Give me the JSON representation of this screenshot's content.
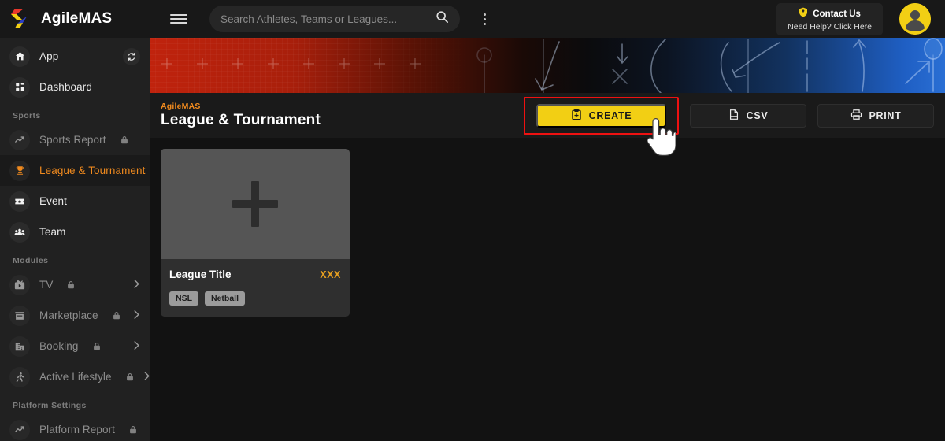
{
  "brand": {
    "name": "AgileMAS",
    "colors": {
      "red": "#e8372c",
      "blue": "#2b3fc4",
      "yellow": "#f2cf14"
    }
  },
  "sidebar": {
    "groups": [
      {
        "label": "",
        "items": [
          {
            "label": "App",
            "icon": "home-icon",
            "locked": false,
            "active": false,
            "trailing": "sync-icon"
          },
          {
            "label": "Dashboard",
            "icon": "dashboard-grid-icon",
            "locked": false,
            "active": false,
            "trailing": ""
          }
        ]
      },
      {
        "label": "Sports",
        "items": [
          {
            "label": "Sports Report",
            "icon": "trend-line-icon",
            "locked": true,
            "active": false,
            "trailing": ""
          },
          {
            "label": "League & Tournament",
            "icon": "trophy-icon",
            "locked": false,
            "active": true,
            "trailing": ""
          },
          {
            "label": "Event",
            "icon": "ticket-star-icon",
            "locked": false,
            "active": false,
            "trailing": ""
          },
          {
            "label": "Team",
            "icon": "people-group-icon",
            "locked": false,
            "active": false,
            "trailing": ""
          }
        ]
      },
      {
        "label": "Modules",
        "items": [
          {
            "label": "TV",
            "icon": "tv-play-icon",
            "locked": true,
            "active": false,
            "trailing": "chevron-right-icon"
          },
          {
            "label": "Marketplace",
            "icon": "store-icon",
            "locked": true,
            "active": false,
            "trailing": "chevron-right-icon"
          },
          {
            "label": "Booking",
            "icon": "building-icon",
            "locked": true,
            "active": false,
            "trailing": "chevron-right-icon"
          },
          {
            "label": "Active Lifestyle",
            "icon": "runner-icon",
            "locked": true,
            "active": false,
            "trailing": "chevron-right-icon"
          }
        ]
      },
      {
        "label": "Platform Settings",
        "items": [
          {
            "label": "Platform Report",
            "icon": "trend-line-icon",
            "locked": true,
            "active": false,
            "trailing": ""
          }
        ]
      }
    ]
  },
  "topbar": {
    "menu_icon": "hamburger-icon",
    "search": {
      "value": "",
      "placeholder": "Search Athletes, Teams or Leagues...",
      "icon": "search-icon"
    },
    "more_icon": "kebab-menu-icon",
    "contact": {
      "title": "Contact Us",
      "subtitle": "Need Help? Click Here",
      "icon": "shield-icon"
    },
    "avatar": "user-avatar"
  },
  "page": {
    "breadcrumb": "AgileMAS",
    "title": "League & Tournament",
    "actions": [
      {
        "label": "CREATE",
        "icon": "clipboard-plus-icon",
        "style": "primary",
        "highlighted": true
      },
      {
        "label": "CSV",
        "icon": "file-icon",
        "style": "ghost",
        "highlighted": false
      },
      {
        "label": "PRINT",
        "icon": "printer-icon",
        "style": "ghost",
        "highlighted": false
      }
    ]
  },
  "cards": [
    {
      "title": "League Title",
      "badge": "XXX",
      "image_placeholder": "plus-icon",
      "tags": [
        "NSL",
        "Netball"
      ]
    }
  ],
  "annotation": {
    "highlight_color": "#ee1111",
    "cursor": "pointing-hand-cursor"
  }
}
